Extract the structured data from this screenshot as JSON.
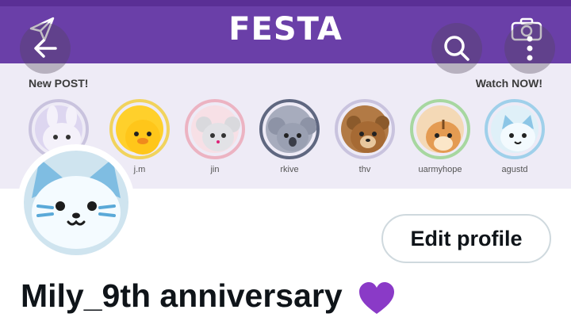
{
  "banner": {
    "title": "FESTA",
    "left_label": "New POST!",
    "right_label": "Watch NOW!",
    "stories": [
      {
        "name": "",
        "color": "#cfc7ea",
        "icon": "bunny-icon"
      },
      {
        "name": "j.m",
        "color": "#f7c52c",
        "icon": "chick-icon"
      },
      {
        "name": "jin",
        "color": "#f2c8d2",
        "icon": "mouse-icon"
      },
      {
        "name": "rkive",
        "color": "#8a8fa0",
        "icon": "koala-icon"
      },
      {
        "name": "thv",
        "color": "#a26a3c",
        "icon": "bear-icon"
      },
      {
        "name": "uarmyhope",
        "color": "#e6a15a",
        "icon": "squirrel-icon"
      },
      {
        "name": "agustd",
        "color": "#d7ecf6",
        "icon": "cat-icon"
      }
    ]
  },
  "nav": {
    "back_icon": "back-arrow-icon",
    "search_icon": "search-icon",
    "more_icon": "more-vertical-icon"
  },
  "profile": {
    "edit_label": "Edit profile",
    "display_name": "Mily_9th anniversary",
    "name_emoji": "purple-heart-icon"
  },
  "colors": {
    "banner_purple": "#6a3fa8",
    "heart_purple": "#8a3ac7"
  }
}
